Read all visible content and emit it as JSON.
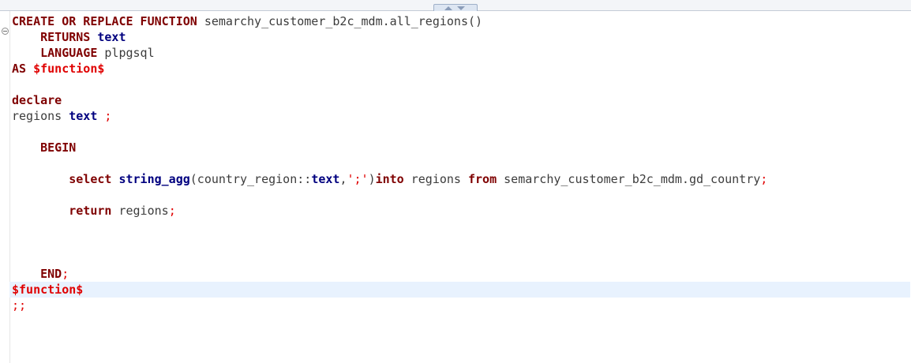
{
  "editor": {
    "line1": {
      "kw": "CREATE OR REPLACE FUNCTION",
      "name": " semarchy_customer_b2c_mdm.all_regions()"
    },
    "line2": {
      "kw": "RETURNS",
      "type": "text"
    },
    "line3": {
      "kw": "LANGUAGE",
      "lang": " plpgsql"
    },
    "line4": {
      "kw": "AS",
      "delim": "$function$"
    },
    "line6": {
      "kw": "declare"
    },
    "line7": {
      "var": "regions ",
      "type": "text",
      "semi": " ;"
    },
    "line9": {
      "kw": "BEGIN"
    },
    "line11": {
      "kw1": "select",
      "fn": "string_agg",
      "p1": "(country_region::",
      "type": "text",
      "p2": ",",
      "str": "';'",
      "p3": ")",
      "kw2": "into",
      "p4": " regions ",
      "kw3": "from",
      "p5": " semarchy_customer_b2c_mdm.gd_country",
      "semi": ";"
    },
    "line13": {
      "kw": "return",
      "p": " regions",
      "semi": ";"
    },
    "line17": {
      "kw": "END",
      "semi": ";"
    },
    "line18": {
      "delim": "$function$"
    },
    "line19": {
      "semi": ";;"
    }
  }
}
